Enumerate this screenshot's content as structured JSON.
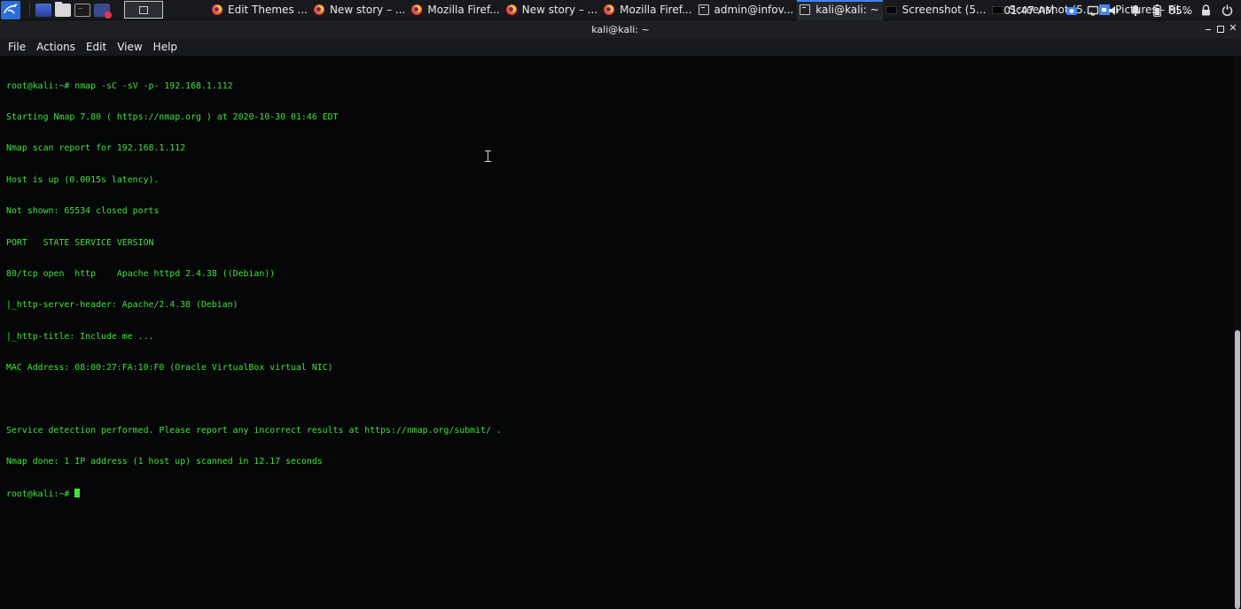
{
  "panel": {
    "tasks": [
      {
        "icon": "firefox-icon",
        "label": "Edit Themes ..."
      },
      {
        "icon": "firefox-icon",
        "label": "New story – ..."
      },
      {
        "icon": "firefox-icon",
        "label": "Mozilla Firef..."
      },
      {
        "icon": "firefox-icon",
        "label": "New story – ..."
      },
      {
        "icon": "firefox-icon",
        "label": "Mozilla Firef..."
      },
      {
        "icon": "terminal-icon",
        "label": "admin@infov..."
      },
      {
        "icon": "terminal-icon",
        "label": "kali@kali: ~",
        "active": true
      },
      {
        "icon": "screenshot-icon",
        "label": "Screenshot (5..."
      },
      {
        "icon": "screenshot-icon",
        "label": "Screenshot (5..."
      },
      {
        "icon": "pictures-icon",
        "label": "Pictures - Fil..."
      }
    ],
    "clock": "01:47 AM",
    "battery": "85%",
    "accent_color": "#3a86ff"
  },
  "window": {
    "title": "kali@kali: ~"
  },
  "menu": [
    "File",
    "Actions",
    "Edit",
    "View",
    "Help"
  ],
  "terminal": {
    "text_color": "#3ee43a",
    "lines": [
      "root@kali:~# nmap -sC -sV -p- 192.168.1.112",
      "Starting Nmap 7.80 ( https://nmap.org ) at 2020-10-30 01:46 EDT",
      "Nmap scan report for 192.168.1.112",
      "Host is up (0.0015s latency).",
      "Not shown: 65534 closed ports",
      "PORT   STATE SERVICE VERSION",
      "80/tcp open  http    Apache httpd 2.4.38 ((Debian))",
      "|_http-server-header: Apache/2.4.38 (Debian)",
      "|_http-title: Include me ...",
      "MAC Address: 08:00:27:FA:10:F0 (Oracle VirtualBox virtual NIC)",
      "",
      "Service detection performed. Please report any incorrect results at https://nmap.org/submit/ .",
      "Nmap done: 1 IP address (1 host up) scanned in 12.17 seconds"
    ],
    "prompt": "root@kali:~# "
  }
}
